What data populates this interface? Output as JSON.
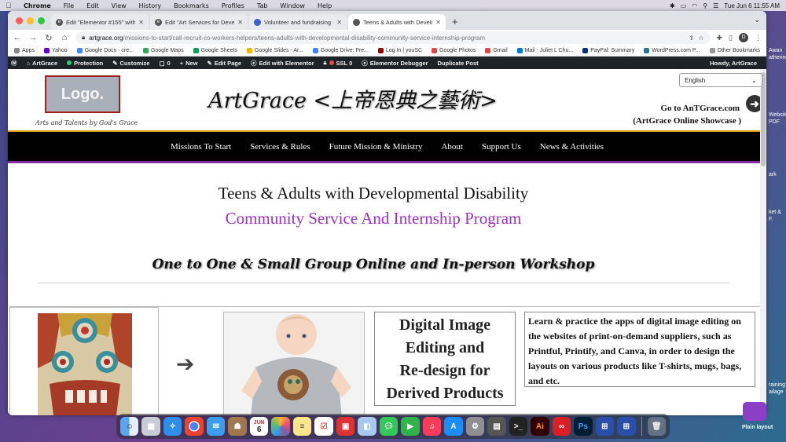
{
  "menubar": {
    "app": "Chrome",
    "items": [
      "File",
      "Edit",
      "View",
      "History",
      "Bookmarks",
      "Profiles",
      "Tab",
      "Window",
      "Help"
    ],
    "datetime": "Tue Jun 6  11:55 AM"
  },
  "desktop": {
    "labels": [
      "Awan",
      "athering",
      "Website",
      "PDF",
      "ark",
      "ket & F.",
      "raining",
      "ailage",
      "Plain layout"
    ]
  },
  "tabs": [
    {
      "title": "Edit \"Elementor #155\" with Ele",
      "active": false
    },
    {
      "title": "Edit \"Art Services for Develop",
      "active": false
    },
    {
      "title": "Volunteer and fundraising - We",
      "active": false
    },
    {
      "title": "Teens & Adults with Developme",
      "active": true
    }
  ],
  "omnibox": {
    "host": "artgrace.org",
    "path": "/missions-to-start/call-recruit-co-workers-helpers/teens-adults-with-developmental-disability-community-service-internship-program"
  },
  "profile_initial": "D",
  "bookmarks": [
    "Apps",
    "Yahoo",
    "Google Docs - cre...",
    "Google Maps",
    "Google Sheets",
    "Google Slides - Ar...",
    "Google Drive: Fre...",
    "Log In | youSC",
    "Google Photos",
    "Gmail",
    "Mail - Juliet L Chu...",
    "PayPal: Summary",
    "WordPress.com P..."
  ],
  "bookmarks_other": "Other Bookmarks",
  "wpbar": {
    "items": [
      "ArtGrace",
      "Protection",
      "Customize",
      "0",
      "New",
      "Edit Page",
      "Edit with Elementor",
      "SSL 0",
      "Elementor Debugger",
      "Duplicate Post"
    ],
    "howdy": "Howdy, ArtGrace"
  },
  "page": {
    "language": "English",
    "logo": "Logo.",
    "tagline": "Arts and Talents by God's Grace",
    "site_title": "ArtGrace <上帝恩典之藝術>",
    "goto_line1": "Go to AnTGrace.com",
    "goto_line2": "(ArtGrace Online Showcase )",
    "nav": [
      "Missions To Start",
      "Services & Rules",
      "Future Mission & Ministry",
      "About",
      "Support Us",
      "News & Activities"
    ],
    "heading1": "Teens & Adults with Developmental Disability",
    "heading2": "Community Service And Internship Program",
    "heading3": "One to One & Small Group Online and In-person Workshop",
    "box_title": "Digital Image Editing and Re-design for Derived Products",
    "box_title_lines": [
      "Digital Image",
      "Editing and",
      "Re-design for",
      "Derived Products"
    ],
    "description": "Learn & practice the apps of digital image editing on the websites of print-on-demand suppliers, such as Printful, Printify, and Canva, in order to design the layouts on various products like T-shirts, mugs, bags, and etc."
  },
  "dock": {
    "calendar_month": "JUN",
    "calendar_day": "6",
    "apps": [
      "Finder",
      "Launchpad",
      "Safari",
      "Chrome",
      "Mail",
      "Contacts",
      "Calendar",
      "Photos",
      "Notes",
      "Reminders",
      "Preview",
      "Messages",
      "FaceTime",
      "Music",
      "App Store",
      "System Preferences",
      "Calculator",
      "Terminal",
      "Illustrator",
      "Creative Cloud",
      "Photoshop",
      "Screen Add",
      "Screen Add 2",
      "Trash"
    ]
  }
}
